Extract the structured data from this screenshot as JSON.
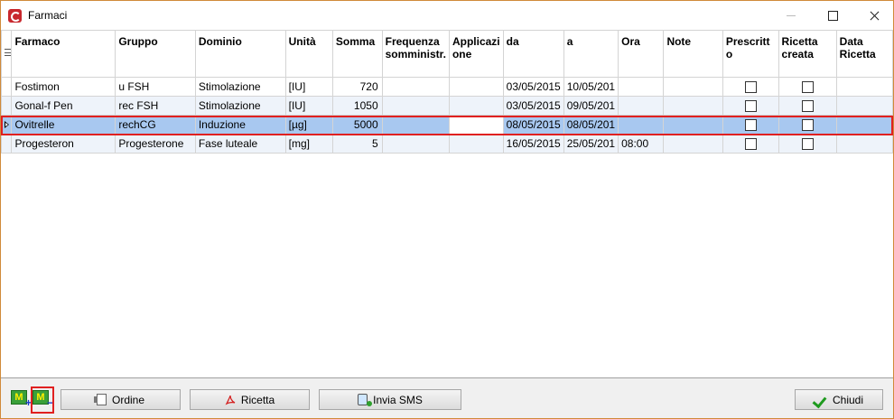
{
  "window": {
    "title": "Farmaci"
  },
  "grid": {
    "columns": [
      "Farmaco",
      "Gruppo",
      "Dominio",
      "Unità",
      "Somma",
      "Frequenza somministr.",
      "Applicazi one",
      "da",
      "a",
      "Ora",
      "Note",
      "Prescritt o",
      "Ricetta creata",
      "Data Ricetta"
    ],
    "rows": [
      {
        "farmaco": "Fostimon",
        "gruppo": "u FSH",
        "dominio": "Stimolazione",
        "unita": "[IU]",
        "somma": "720",
        "frequenza": "",
        "applicazione": "",
        "da": "03/05/2015",
        "a": "10/05/201",
        "ora": "",
        "note": "",
        "prescritto": false,
        "ricetta_creata": false,
        "data_ricetta": ""
      },
      {
        "farmaco": "Gonal-f Pen",
        "gruppo": "rec FSH",
        "dominio": "Stimolazione",
        "unita": "[IU]",
        "somma": "1050",
        "frequenza": "",
        "applicazione": "",
        "da": "03/05/2015",
        "a": "09/05/201",
        "ora": "",
        "note": "",
        "prescritto": false,
        "ricetta_creata": false,
        "data_ricetta": ""
      },
      {
        "farmaco": "Ovitrelle",
        "gruppo": "rechCG",
        "dominio": "Induzione",
        "unita": "[µg]",
        "somma": "5000",
        "frequenza": "",
        "applicazione": "",
        "da": "08/05/2015",
        "a": "08/05/201",
        "ora": "",
        "note": "",
        "prescritto": false,
        "ricetta_creata": false,
        "data_ricetta": ""
      },
      {
        "farmaco": "Progesteron",
        "gruppo": "Progesterone",
        "dominio": "Fase luteale",
        "unita": "[mg]",
        "somma": "5",
        "frequenza": "",
        "applicazione": "",
        "da": "16/05/2015",
        "a": "25/05/201",
        "ora": "08:00",
        "note": "",
        "prescritto": false,
        "ricetta_creata": false,
        "data_ricetta": ""
      }
    ]
  },
  "toolbar": {
    "add_icon_letter": "M",
    "remove_icon_letter": "M",
    "ordine_label": "Ordine",
    "ricetta_label": "Ricetta",
    "invia_sms_label": "Invia SMS",
    "chiudi_label": "Chiudi"
  },
  "colors": {
    "selected_row": "#a8c8f0",
    "alt_row": "#eef3fa",
    "highlight_outline": "#e02020",
    "accent_check": "#1e9a1e"
  }
}
